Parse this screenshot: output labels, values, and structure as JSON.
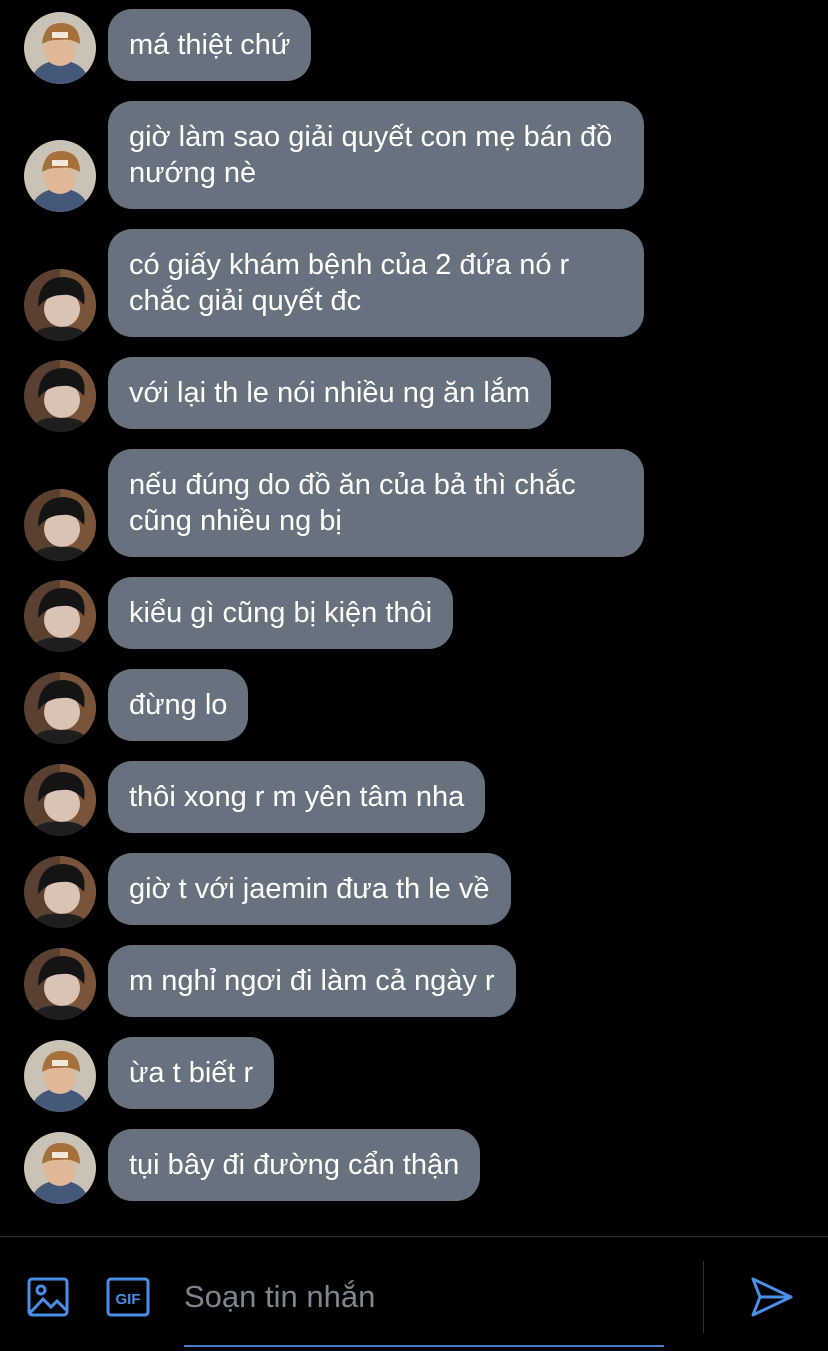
{
  "colors": {
    "bubble": "#67727e",
    "accent": "#4a8fe7",
    "background": "#000000"
  },
  "messages": [
    {
      "text": "má thiệt chứ",
      "sender": "friend-beanie"
    },
    {
      "text": "giờ làm sao giải quyết con mẹ bán đồ nướng nè",
      "sender": "friend-beanie"
    },
    {
      "text": "có giấy khám bệnh của 2 đứa nó r chắc giải quyết đc",
      "sender": "friend-dark"
    },
    {
      "text": "với lại th le nói nhiều ng ăn lắm",
      "sender": "friend-dark"
    },
    {
      "text": "nếu đúng do đồ ăn của bả thì chắc cũng nhiều ng bị",
      "sender": "friend-dark"
    },
    {
      "text": "kiểu gì cũng bị kiện thôi",
      "sender": "friend-dark"
    },
    {
      "text": "đừng lo",
      "sender": "friend-dark"
    },
    {
      "text": "thôi xong r m yên tâm nha",
      "sender": "friend-dark"
    },
    {
      "text": "giờ t với jaemin đưa th le về",
      "sender": "friend-dark"
    },
    {
      "text": "m nghỉ ngơi đi làm cả ngày r",
      "sender": "friend-dark"
    },
    {
      "text": "ừa t biết r",
      "sender": "friend-beanie"
    },
    {
      "text": "tụi bây đi đường cẩn thận",
      "sender": "friend-beanie"
    }
  ],
  "composer": {
    "placeholder": "Soạn tin nhắn",
    "icons": {
      "image": "image-icon",
      "gif": "gif-icon",
      "send": "send-icon"
    },
    "gif_label": "GIF"
  }
}
